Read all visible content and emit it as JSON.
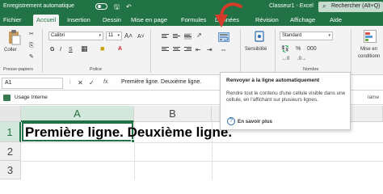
{
  "titlebar": {
    "autosave": "Enregistrement automatique",
    "filename": "Classeur1 - Excel",
    "search_placeholder": "Rechercher (Alt+Q)"
  },
  "tabs": [
    "Fichier",
    "Accueil",
    "Insertion",
    "Dessin",
    "Mise en page",
    "Formules",
    "Données",
    "Révision",
    "Affichage",
    "Aide"
  ],
  "ribbon": {
    "paste_label": "Coller",
    "clipboard_group": "Presse-papiers",
    "font_name": "Calibri",
    "font_size": "11",
    "bold": "G",
    "italic": "I",
    "underline": "S",
    "font_group": "Police",
    "alignment_group": "Alignement",
    "sensitivity_label": "Sensibilité",
    "sensitivity_group": "Sensibilité",
    "number_format": "Standard",
    "number_group": "Nombre",
    "conditional_label_1": "Mise en",
    "conditional_label_2": "conditionn"
  },
  "formula_bar": {
    "name_box": "A1",
    "fx": "fx",
    "content": "Première ligne. Deuxième ligne."
  },
  "sensitivity_bar": {
    "label": "Usage Interne",
    "right_text": "lame"
  },
  "grid": {
    "columns": [
      "A",
      "B",
      "C"
    ],
    "rows": [
      "1",
      "2",
      "3"
    ],
    "a1_text": "Première ligne. Deuxième ligne."
  },
  "tooltip": {
    "title": "Renvoyer à la ligne automatiquement",
    "description": "Rendre tout le contenu d'une cellule visible dans une cellule, en l'affichant sur plusieurs lignes.",
    "learn_more": "En savoir plus"
  },
  "colors": {
    "excel_green": "#217346",
    "arrow_red": "#d63a2a"
  }
}
